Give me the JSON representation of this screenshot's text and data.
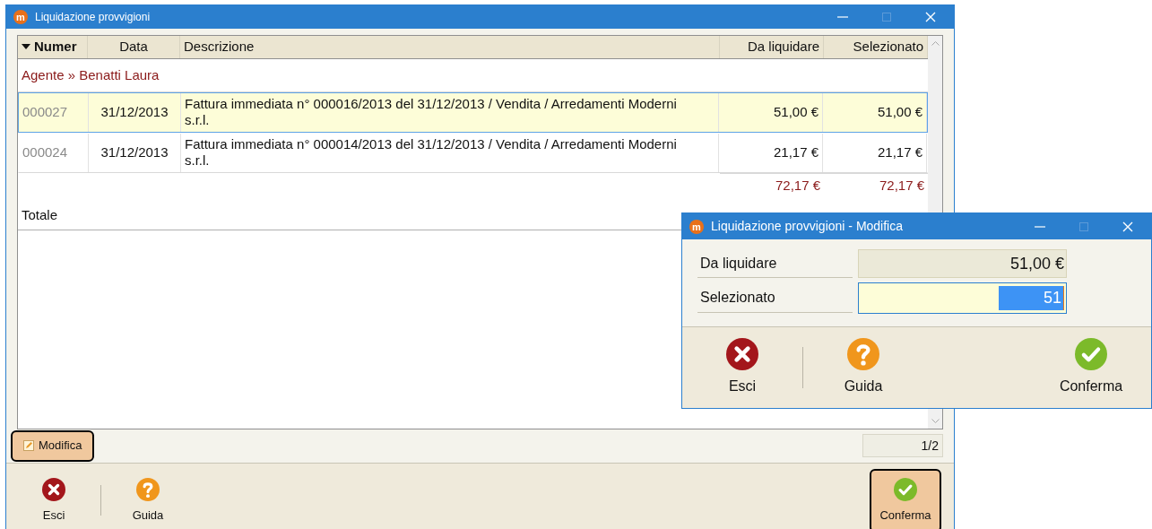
{
  "main_window": {
    "icon_letter": "m",
    "title": "Liquidazione provvigioni",
    "table": {
      "columns": [
        {
          "label": "Numer",
          "sorted": true
        },
        {
          "label": "Data",
          "sorted": false
        },
        {
          "label": "Descrizione",
          "sorted": false
        },
        {
          "label": "Da liquidare",
          "sorted": false
        },
        {
          "label": "Selezionato",
          "sorted": false
        }
      ],
      "group": "Agente » Benatti Laura",
      "rows": [
        {
          "numero": "000027",
          "data": "31/12/2013",
          "descrizione": "Fattura immediata n° 000016/2013 del 31/12/2013 / Vendita / Arredamenti Moderni s.r.l.",
          "da_liquidare": "51,00 €",
          "selezionato": "51,00 €",
          "selected": true
        },
        {
          "numero": "000024",
          "data": "31/12/2013",
          "descrizione": "Fattura immediata n° 000014/2013 del 31/12/2013 / Vendita / Arredamenti Moderni s.r.l.",
          "da_liquidare": "21,17 €",
          "selezionato": "21,17 €",
          "selected": false
        }
      ],
      "totals": {
        "da_liquidare": "72,17 €",
        "selezionato": "72,17 €"
      },
      "total_label": "Totale"
    },
    "edit_button": {
      "label": "Modifica",
      "highlighted": true
    },
    "pager": "1/2",
    "toolbar": [
      {
        "kind": "exit",
        "label": "Esci",
        "highlighted": false
      },
      {
        "kind": "help",
        "label": "Guida",
        "highlighted": false
      },
      {
        "kind": "confirm",
        "label": "Conferma",
        "highlighted": true
      }
    ]
  },
  "dialog": {
    "icon_letter": "m",
    "title": "Liquidazione provvigioni - Modifica",
    "fields": [
      {
        "label": "Da liquidare",
        "value": "51,00 €",
        "kind": "readonly"
      },
      {
        "label": "Selezionato",
        "value": "51",
        "kind": "editable"
      }
    ],
    "toolbar": [
      {
        "kind": "exit",
        "label": "Esci",
        "highlighted": false
      },
      {
        "kind": "help",
        "label": "Guida",
        "highlighted": false
      },
      {
        "kind": "confirm",
        "label": "Conferma",
        "highlighted": false
      }
    ]
  }
}
